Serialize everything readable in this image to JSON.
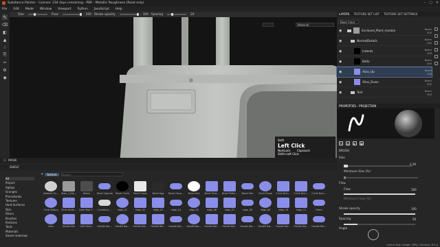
{
  "window": {
    "title": "Substance Painter - License: 234 days remaining - PBR - Metallic Roughness (Read only)",
    "controls": [
      "–",
      "▢",
      "✕"
    ]
  },
  "menu": [
    "File",
    "Edit",
    "Mode",
    "Window",
    "Viewport",
    "Python",
    "JavaScript",
    "Help"
  ],
  "tool_options": {
    "size_label": "Size",
    "flow_label": "Flow",
    "flow_value": "100",
    "stroke_opacity_label": "Stroke opacity",
    "stroke_opacity_value": "100",
    "spacing_label": "Spacing",
    "spacing_value": "20"
  },
  "viewport": {
    "material_dropdown": "Material",
    "mouse_hint": {
      "shift": "Shift",
      "main": "Left Click",
      "numlock": "NumLock",
      "capslock": "CapsLock",
      "sub": "Shift+Left Click"
    }
  },
  "mask_bar": {
    "label": "MASK"
  },
  "shelf": {
    "title": "SHELF",
    "search_chip": "texture",
    "search_placeholder": "Search...",
    "categories": [
      "All",
      "Project",
      "Alphas",
      "Grunges",
      "Procedurals",
      "Textures",
      "Hard Surfaces",
      "Skin",
      "Filters",
      "Brushes",
      "Particles",
      "Tools",
      "Materials",
      "Smart materials"
    ],
    "selected_category": "All",
    "items": [
      {
        "label": "Ambient Oc...",
        "color": "#d0d0d0"
      },
      {
        "label": "Atlas_3_Ext...",
        "color": "#9a9a9a"
      },
      {
        "label": "Attach",
        "color": "#4d4d4d"
      },
      {
        "label": "Bevel Capsule",
        "color": "#8a8ee8"
      },
      {
        "label": "Bevel Circle",
        "color": "#000000"
      },
      {
        "label": "Bevel Cross",
        "color": "#e8e8e8"
      },
      {
        "label": "Bevel Egg",
        "color": "#2a2a2a"
      },
      {
        "label": "Bevel Hexa...",
        "color": "#8a8ee8"
      },
      {
        "label": "Bevel Line",
        "color": "#ffffff"
      },
      {
        "label": "Bevel Octo...",
        "color": "#8a8ee8"
      },
      {
        "label": "Bevel Platin...",
        "color": "#8a8ee8"
      },
      {
        "label": "Bevel Star",
        "color": "#8a8ee8"
      },
      {
        "label": "Circle Bump",
        "color": "#8a8ee8"
      },
      {
        "label": "Circle Burn...",
        "color": "#8a8ee8"
      },
      {
        "label": "Circle Burn...",
        "color": "#8a8ee8"
      },
      {
        "label": "Circle Burn...",
        "color": "#8a8ee8"
      },
      {
        "label": "Circle Button",
        "color": "#8a8ee8"
      },
      {
        "label": "Circle Butto...",
        "color": "#8a8ee8"
      },
      {
        "label": "Color Map T...",
        "color": "#8a8ee8"
      },
      {
        "label": "Curvature_...",
        "color": "#d8d8d8"
      },
      {
        "label": "edge_01",
        "color": "#8a8ee8"
      },
      {
        "label": "edge_02",
        "color": "#8a8ee8"
      },
      {
        "label": "edge_03",
        "color": "#8a8ee8"
      },
      {
        "label": "edge_04",
        "color": "#8a8ee8"
      },
      {
        "label": "edge_05",
        "color": "#8a8ee8"
      },
      {
        "label": "edge_06",
        "color": "#8a8ee8"
      },
      {
        "label": "edge_07",
        "color": "#8a8ee8"
      },
      {
        "label": "edge_08",
        "color": "#8a8ee8"
      },
      {
        "label": "edge_09",
        "color": "#8a8ee8"
      },
      {
        "label": "edge_10",
        "color": "#8a8ee8"
      },
      {
        "label": "edge_11",
        "color": "#8a8ee8"
      },
      {
        "label": "Fibers",
        "color": "#8a8ee8"
      },
      {
        "label": "Gear",
        "color": "#8a8ee8"
      },
      {
        "label": "Handle Bar",
        "color": "#8a8ee8"
      },
      {
        "label": "Grid Hexa...",
        "color": "#8a8ee8"
      },
      {
        "label": "Handle Bar...",
        "color": "#8a8ee8"
      },
      {
        "label": "Handle Bar...",
        "color": "#8a8ee8"
      },
      {
        "label": "Handle Bar...",
        "color": "#8a8ee8"
      },
      {
        "label": "Handle Bar...",
        "color": "#8a8ee8"
      },
      {
        "label": "Handle Bar...",
        "color": "#8a8ee8"
      },
      {
        "label": "Handle Bar...",
        "color": "#8a8ee8"
      },
      {
        "label": "Handle Bar...",
        "color": "#8a8ee8"
      },
      {
        "label": "Handle Bar...",
        "color": "#8a8ee8"
      },
      {
        "label": "Handle Bar...",
        "color": "#8a8ee8"
      },
      {
        "label": "Handle Bar...",
        "color": "#8a8ee8"
      },
      {
        "label": "Handle Bar...",
        "color": "#8a8ee8"
      },
      {
        "label": "Handle Bar...",
        "color": "#8a8ee8"
      },
      {
        "label": "Handle Bar...",
        "color": "#8a8ee8"
      }
    ]
  },
  "right_dock": {
    "tabs": [
      "LAYERS",
      "TEXTURE SET LIST",
      "TEXTURE SET SETTINGS"
    ],
    "active_tab": "LAYERS",
    "blend_mode": "Base Color",
    "layers": [
      {
        "name": "Enclosed_Plant_module",
        "type": "folder",
        "thumb": "#9d9d9d",
        "blend": "Norm",
        "opacity": "100",
        "selected": false,
        "indent": 0
      },
      {
        "name": "NormalDetails",
        "type": "folder",
        "thumb": "",
        "blend": "Norm",
        "opacity": "100",
        "selected": false,
        "indent": 1
      },
      {
        "name": "Indents",
        "type": "layer",
        "thumb": "#000000",
        "blend": "Norm",
        "opacity": "100",
        "selected": false,
        "indent": 2
      },
      {
        "name": "Bolts",
        "type": "layer",
        "thumb": "#000000",
        "blend": "Norm",
        "opacity": "100",
        "selected": false,
        "indent": 2
      },
      {
        "name": "Alias_Up",
        "type": "layer",
        "thumb": "#8a8ee8",
        "blend": "Norm",
        "opacity": "100",
        "selected": true,
        "indent": 2
      },
      {
        "name": "Alias_Down",
        "type": "layer",
        "thumb": "#8a8ee8",
        "blend": "Norm",
        "opacity": "100",
        "selected": false,
        "indent": 2
      },
      {
        "name": "Text",
        "type": "folder",
        "thumb": "",
        "blend": "Norm",
        "opacity": "100",
        "selected": false,
        "indent": 1
      }
    ],
    "properties": {
      "title": "PROPERTIES - PROJECTION",
      "section_brush": "BRUSH",
      "size_label": "Size",
      "size_value": "2.39",
      "min_size_label": "Minimum Size (%)",
      "flow_label": "Flow",
      "flow_value": "100",
      "flow_sub_label": "Flow",
      "min_flow_label": "Minimum Flow (%)",
      "stroke_opacity_label": "Stroke opacity",
      "stroke_opacity_value": "100",
      "spacing_label": "Spacing",
      "spacing_value": "20",
      "angle_label": "Angle"
    }
  },
  "status": {
    "text": "Cache Disk Usage: 38% | Version: 6.2.x"
  },
  "colors": {
    "accent": "#3b4f66",
    "selected_layer": "#2f3e52",
    "normal_map": "#8a8ee8"
  }
}
